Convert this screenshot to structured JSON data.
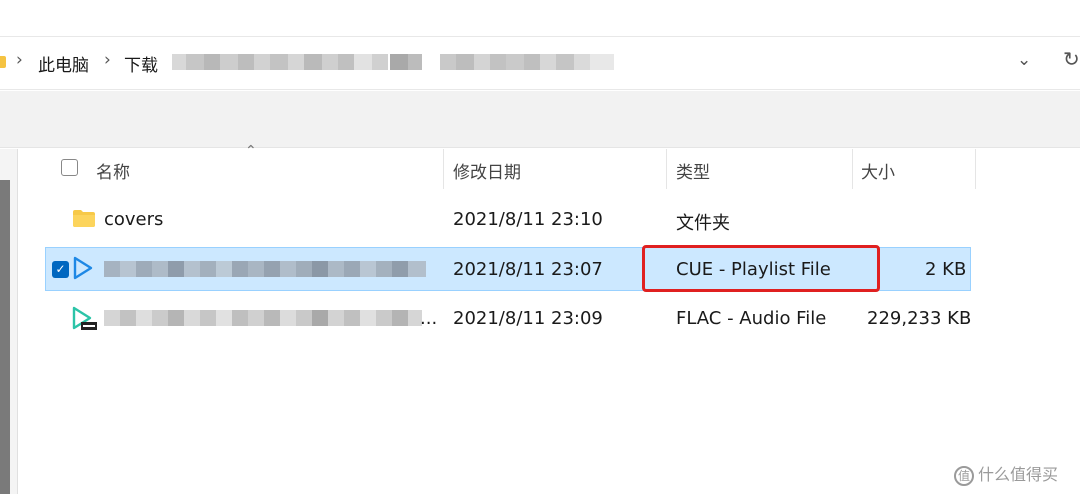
{
  "address_bar": {
    "breadcrumbs": [
      "此电脑",
      "下载"
    ],
    "separator": "›"
  },
  "columns": {
    "name": "名称",
    "date": "修改日期",
    "type": "类型",
    "size": "大小"
  },
  "files": [
    {
      "name": "covers",
      "date": "2021/8/11 23:10",
      "type": "文件夹",
      "size": "",
      "icon": "folder-icon",
      "selected": false
    },
    {
      "name": "",
      "date": "2021/8/11 23:07",
      "type": "CUE - Playlist File",
      "size": "2 KB",
      "icon": "playlist-play-icon",
      "selected": true
    },
    {
      "name": "...",
      "date": "2021/8/11 23:09",
      "type": "FLAC - Audio File",
      "size": "229,233 KB",
      "icon": "flac-audio-icon",
      "selected": false
    }
  ],
  "watermark": {
    "text": "什么值得买",
    "icon": "zhi-icon",
    "icon_glyph": "值"
  },
  "colors": {
    "selection": "#cce8ff",
    "highlight_box": "#e02020",
    "checkbox": "#0067c0"
  }
}
